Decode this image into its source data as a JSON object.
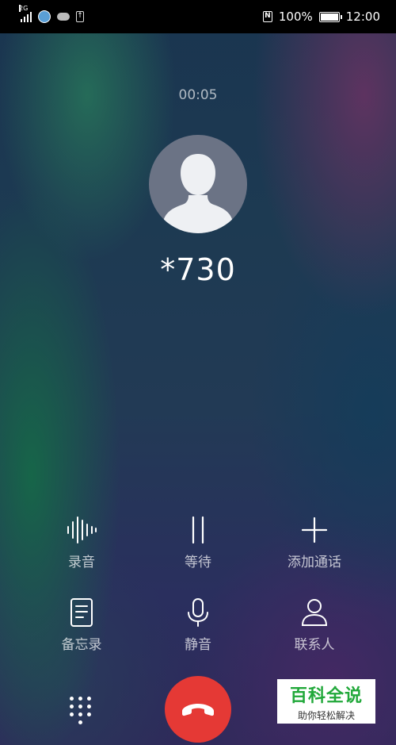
{
  "status_bar": {
    "network": "2G",
    "battery": "100%",
    "time": "12:00"
  },
  "call": {
    "timer": "00:05",
    "number": "*730"
  },
  "controls": {
    "record": "录音",
    "hold": "等待",
    "add_call": "添加通话",
    "memo": "备忘录",
    "mute": "静音",
    "contacts": "联系人"
  },
  "watermark": {
    "title": "百科全说",
    "subtitle": "助你轻松解决"
  },
  "colors": {
    "hangup": "#e53935",
    "watermark_green": "#21a83a"
  }
}
